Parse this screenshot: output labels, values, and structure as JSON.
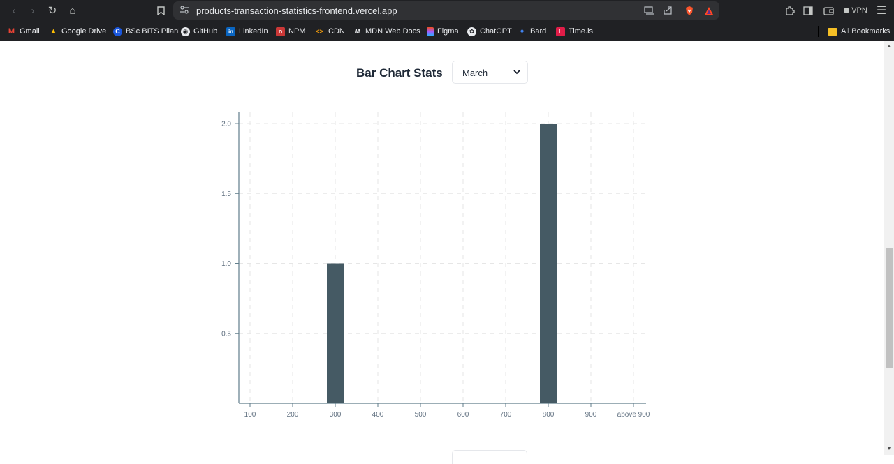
{
  "browser": {
    "url": "products-transaction-statistics-frontend.vercel.app",
    "vpn_label": "VPN",
    "bookmarks": [
      {
        "label": "Gmail",
        "icon": "gmail-icon",
        "color": "#ea4335",
        "glyph": "M"
      },
      {
        "label": "Google Drive",
        "icon": "google-drive-icon",
        "color": "#fbbc04",
        "glyph": "▲"
      },
      {
        "label": "BSc BITS Pilani",
        "icon": "bits-pilani-icon",
        "color": "#1a56db",
        "glyph": "C"
      },
      {
        "label": "GitHub",
        "icon": "github-icon",
        "color": "#e8eaed",
        "glyph": "◉"
      },
      {
        "label": "LinkedIn",
        "icon": "linkedin-icon",
        "color": "#0a66c2",
        "glyph": "in"
      },
      {
        "label": "NPM",
        "icon": "npm-icon",
        "color": "#cb3837",
        "glyph": "n"
      },
      {
        "label": "CDN",
        "icon": "code-icon",
        "color": "#f59e0b",
        "glyph": "<>"
      },
      {
        "label": "MDN Web Docs",
        "icon": "mdn-icon",
        "color": "#202124",
        "glyph": "M"
      },
      {
        "label": "Figma",
        "icon": "figma-icon",
        "color": "#f24e1e",
        "glyph": "F"
      },
      {
        "label": "ChatGPT",
        "icon": "chatgpt-icon",
        "color": "#e8eaed",
        "glyph": "✿"
      },
      {
        "label": "Bard",
        "icon": "bard-icon",
        "color": "#4285f4",
        "glyph": "✦"
      },
      {
        "label": "Time.is",
        "icon": "timeis-icon",
        "color": "#e11d48",
        "glyph": "L"
      }
    ],
    "all_bookmarks_label": "All Bookmarks"
  },
  "page": {
    "title": "Bar Chart Stats",
    "month_select": {
      "selected": "March"
    }
  },
  "chart_data": {
    "type": "bar",
    "categories": [
      "100",
      "200",
      "300",
      "400",
      "500",
      "600",
      "700",
      "800",
      "900",
      "above 900"
    ],
    "values": [
      0,
      0,
      1,
      0,
      0,
      0,
      0,
      2,
      0,
      0
    ],
    "yticks": [
      "0.5",
      "1.0",
      "1.5",
      "2.0"
    ],
    "ylim": [
      0,
      2.08
    ],
    "grid": true,
    "bar_color": "#455a64",
    "axis_color": "#607d8b"
  }
}
